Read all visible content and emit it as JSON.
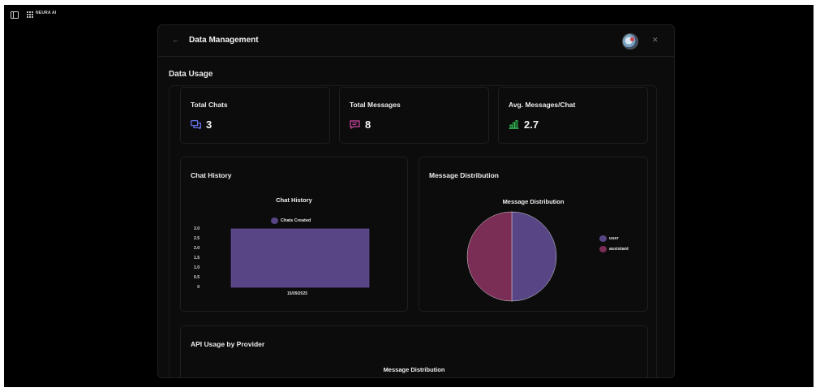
{
  "app": {
    "brand": "NEURA AI"
  },
  "modal": {
    "title": "Data Management"
  },
  "data_usage": {
    "section_title": "Data Usage",
    "stats": [
      {
        "label": "Total Chats",
        "value": "3",
        "icon": "chat-bubbles-icon",
        "color": "#6f7cff"
      },
      {
        "label": "Total Messages",
        "value": "8",
        "icon": "message-square-icon",
        "color": "#d24aa6"
      },
      {
        "label": "Avg. Messages/Chat",
        "value": "2.7",
        "icon": "bar-chart-icon",
        "color": "#34c759"
      }
    ]
  },
  "chat_history": {
    "card_title": "Chat History"
  },
  "message_distribution": {
    "card_title": "Message Distribution"
  },
  "api_usage": {
    "card_title": "API Usage by Provider",
    "chart_title": "Message Distribution"
  },
  "chart_data": [
    {
      "type": "bar",
      "title": "Chat History",
      "categories": [
        "15/09/2025"
      ],
      "series": [
        {
          "name": "Chats Created",
          "values": [
            3
          ],
          "color": "#574586"
        }
      ],
      "yticks": [
        "3.0",
        "2.5",
        "2.0",
        "1.5",
        "1.0",
        "0.5",
        "0"
      ],
      "ylim": [
        0,
        3
      ],
      "legend": "top"
    },
    {
      "type": "pie",
      "title": "Message Distribution",
      "labels": [
        "user",
        "assistant"
      ],
      "values": [
        4,
        4
      ],
      "colors": [
        "#574586",
        "#7a2d55"
      ],
      "legend": "right"
    }
  ]
}
